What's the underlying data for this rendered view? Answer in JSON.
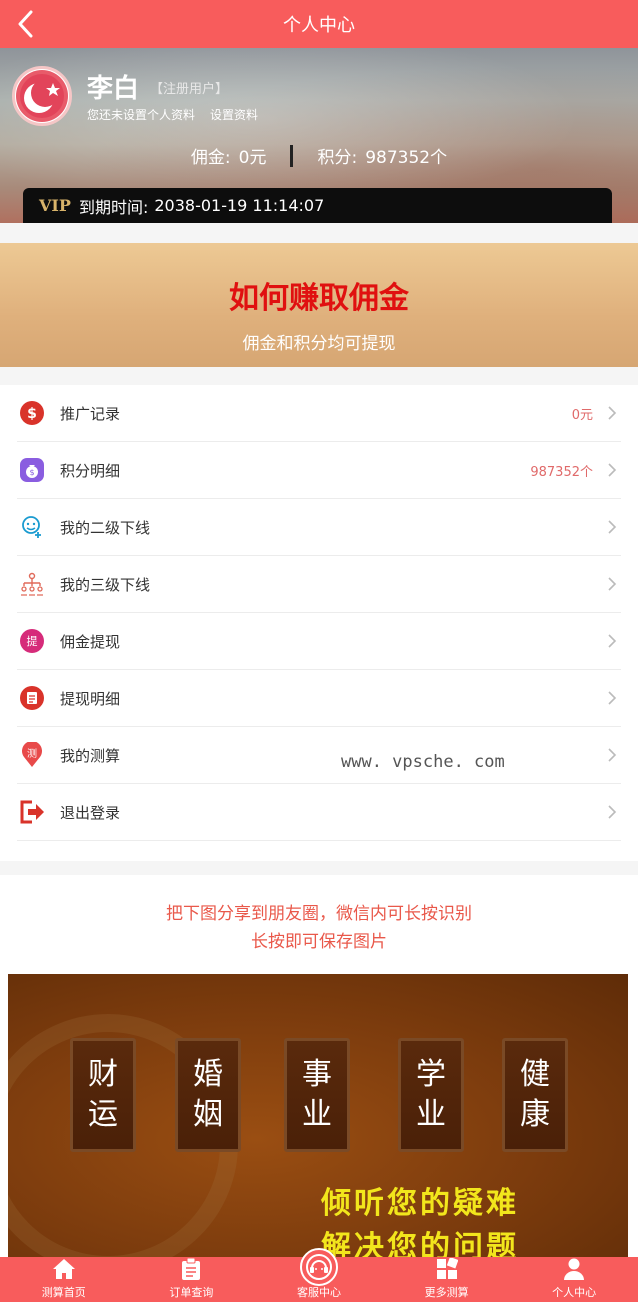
{
  "header": {
    "title": "个人中心",
    "back_icon": "chevron-left-icon"
  },
  "profile": {
    "avatar_icon": "crescent-star-icon",
    "name": "李白",
    "user_type": "【注册用户】",
    "hint": "您还未设置个人资料",
    "settings_link": "设置资料",
    "commission_label": "佣金:",
    "commission_value": "0元",
    "points_label": "积分:",
    "points_value": "987352个",
    "vip_badge": "VIP",
    "expire_label": "到期时间:",
    "expire_value": "2038-01-19 11:14:07"
  },
  "banner": {
    "title": "如何赚取佣金",
    "subtitle": "佣金和积分均可提现"
  },
  "menu": {
    "items": [
      {
        "label": "推广记录",
        "value": "0元",
        "icon": "dollar-coin-icon"
      },
      {
        "label": "积分明细",
        "value": "987352个",
        "icon": "money-bag-icon"
      },
      {
        "label": "我的二级下线",
        "value": "",
        "icon": "user-add-icon"
      },
      {
        "label": "我的三级下线",
        "value": "",
        "icon": "org-tree-icon"
      },
      {
        "label": "佣金提现",
        "value": "",
        "icon": "withdraw-icon"
      },
      {
        "label": "提现明细",
        "value": "",
        "icon": "list-doc-icon"
      },
      {
        "label": "我的测算",
        "value": "",
        "icon": "location-pin-icon"
      },
      {
        "label": "退出登录",
        "value": "",
        "icon": "logout-icon"
      }
    ]
  },
  "watermark": "www. vpsche. com",
  "share": {
    "line1": "把下图分享到朋友圈，微信内可长按识别",
    "line2": "长按即可保存图片",
    "tiles": [
      {
        "top": "财",
        "bottom": "运"
      },
      {
        "top": "婚",
        "bottom": "姻"
      },
      {
        "top": "事",
        "bottom": "业"
      },
      {
        "top": "学",
        "bottom": "业"
      },
      {
        "top": "健",
        "bottom": "康"
      }
    ],
    "slogan1": "倾听您的疑难",
    "slogan2": "解决您的问题"
  },
  "tabbar": {
    "items": [
      {
        "label": "测算首页",
        "icon": "home-icon"
      },
      {
        "label": "订单查询",
        "icon": "clipboard-icon"
      },
      {
        "label": "客服中心",
        "icon": "headset-icon"
      },
      {
        "label": "更多测算",
        "icon": "grid-icon"
      },
      {
        "label": "个人中心",
        "icon": "user-icon"
      }
    ]
  },
  "colors": {
    "primary": "#f85c5c",
    "banner_title": "#e01010",
    "share_text": "#e9584a",
    "value_text": "#e06a6a",
    "slogan": "#f2e61c"
  }
}
